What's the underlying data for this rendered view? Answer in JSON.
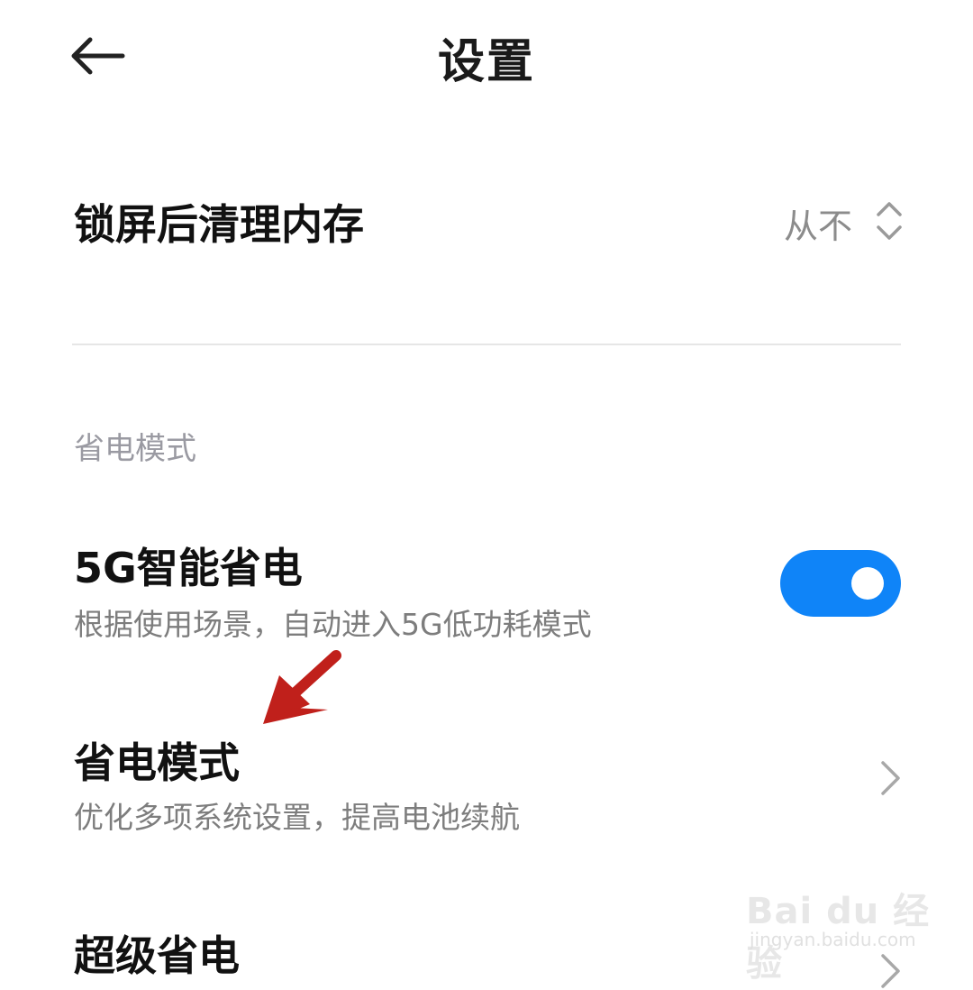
{
  "header": {
    "title": "设置",
    "back_icon": "arrow-left-icon"
  },
  "memory_row": {
    "title": "锁屏后清理内存",
    "value": "从不",
    "icon": "up-down-chevron-icon"
  },
  "section": {
    "label": "省电模式"
  },
  "rows": [
    {
      "title": "5G智能省电",
      "subtitle": "根据使用场景，自动进入5G低功耗模式",
      "toggle_on": true,
      "toggle_color": "#0f84f8"
    },
    {
      "title": "省电模式",
      "subtitle": "优化多项系统设置，提高电池续航",
      "icon": "chevron-right-icon"
    },
    {
      "title": "超级省电",
      "icon": "chevron-right-icon"
    }
  ],
  "annotation": {
    "arrow_color": "#c0201b"
  },
  "watermark": {
    "brand": "Bai du 经验",
    "url": "jingyan.baidu.com"
  }
}
